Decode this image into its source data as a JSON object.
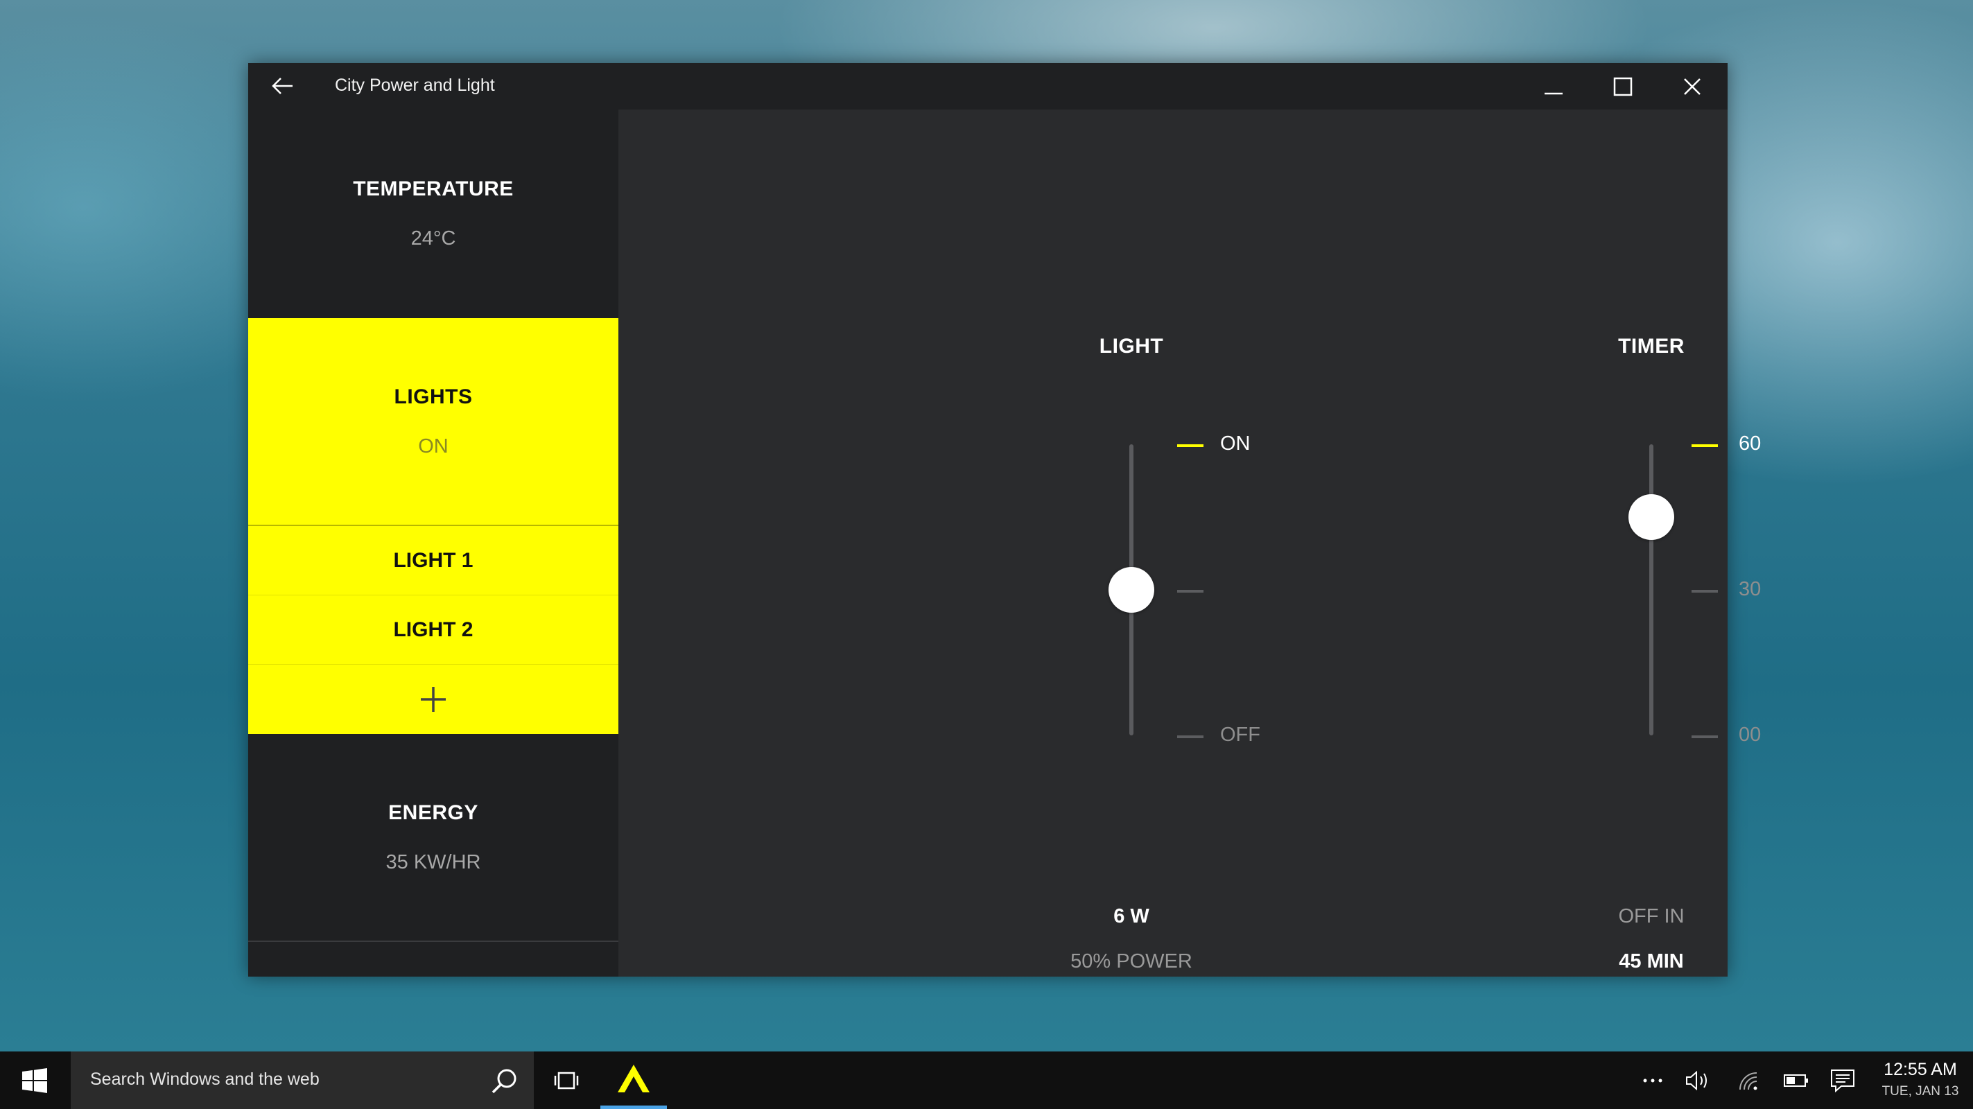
{
  "window": {
    "title": "City Power and Light"
  },
  "sidebar": {
    "temperature": {
      "title": "TEMPERATURE",
      "value": "24°C"
    },
    "lights": {
      "title": "LIGHTS",
      "value": "ON",
      "items": [
        {
          "label": "LIGHT 1"
        },
        {
          "label": "LIGHT 2"
        }
      ],
      "add_label": "+"
    },
    "energy": {
      "title": "ENERGY",
      "value": "35 KW/HR"
    }
  },
  "light_panel": {
    "title": "LIGHT",
    "level_fraction": 0.5,
    "ticks": [
      {
        "label": "ON",
        "active": true
      },
      {
        "label": "",
        "active": false
      },
      {
        "label": "OFF",
        "active": false
      }
    ],
    "readout_primary": "6 W",
    "readout_secondary": "50% POWER"
  },
  "timer_panel": {
    "title": "TIMER",
    "value_minutes": 45,
    "max_minutes": 60,
    "ticks": [
      {
        "label": "60",
        "active": true
      },
      {
        "label": "30",
        "active": false
      },
      {
        "label": "00",
        "active": false
      }
    ],
    "readout_label": "OFF IN",
    "readout_value": "45 MIN"
  },
  "taskbar": {
    "search_placeholder": "Search Windows and the web",
    "clock_time": "12:55 AM",
    "clock_date": "TUE, JAN 13"
  },
  "colors": {
    "accent": "#ffff00",
    "window_bg": "#2a2b2d",
    "sidebar_bg": "#1f2022",
    "taskbar_bg": "#101010"
  }
}
